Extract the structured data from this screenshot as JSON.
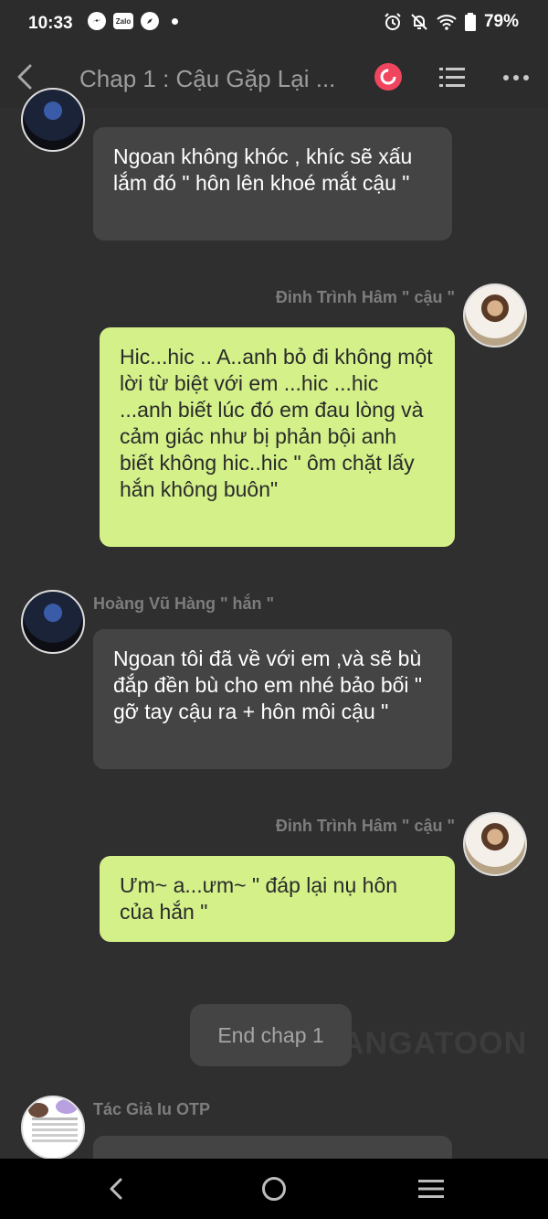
{
  "status_bar": {
    "time": "10:33",
    "zalo_label": "Zalo",
    "battery": "79%"
  },
  "header": {
    "title": "Chap 1 : Cậu Gặp Lại ..."
  },
  "messages": [
    {
      "side": "left",
      "text": "Ngoan không khóc , khíc sẽ xấu lắm đó \" hôn lên khoé mắt cậu \""
    },
    {
      "side": "right",
      "name": "Đinh Trình Hâm \" cậu \"",
      "text": "Hic...hic .. A..anh bỏ đi không một lời từ biệt với em ...hic ...hic ...anh biết lúc đó em đau lòng và cảm giác như bị phản bội anh biết không hic..hic \" ôm chặt lấy hắn không buôn\""
    },
    {
      "side": "left",
      "name": "Hoàng Vũ Hàng \" hắn \"",
      "text": "Ngoan tôi đã về với em ,và sẽ bù đắp đền bù cho em nhé bảo bối \" gỡ tay cậu ra + hôn môi cậu \""
    },
    {
      "side": "right",
      "name": "Đinh Trình Hâm \" cậu \"",
      "text": "Ưm~ a...ưm~ \" đáp lại nụ hôn của hắn \""
    }
  ],
  "end_chip": "End chap 1",
  "watermark": "ANGATOON",
  "author": {
    "name": "Tác Giả Iu OTP"
  },
  "colors": {
    "background": "#2f2f2f",
    "left_bubble": "#444444",
    "right_bubble": "#d3f089",
    "record_button": "#f0455e"
  }
}
